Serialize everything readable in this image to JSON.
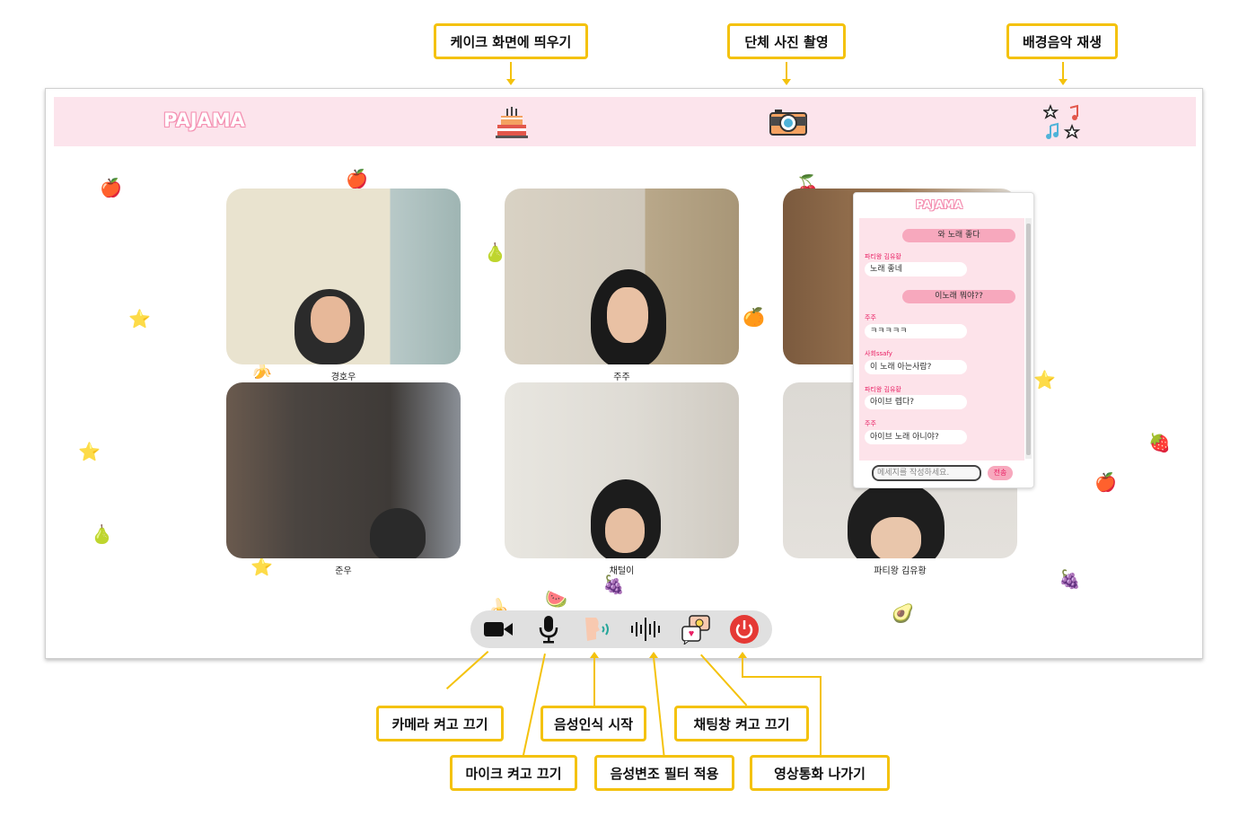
{
  "annotations": {
    "cake": "케이크 화면에 띄우기",
    "photo": "단체 사진 촬영",
    "music": "배경음악 재생",
    "camera": "카메라 켜고 끄기",
    "mic": "마이크 켜고 끄기",
    "speech": "음성인식 시작",
    "voice_filter": "음성변조 필터 적용",
    "chat": "채팅창 켜고 끄기",
    "leave": "영상통화 나가기"
  },
  "app": {
    "logo": "PAJAMA",
    "participants": [
      {
        "name": "경호우"
      },
      {
        "name": "주주"
      },
      {
        "name": ""
      },
      {
        "name": "준우"
      },
      {
        "name": "채털이"
      },
      {
        "name": "파티왕 김유황"
      }
    ],
    "chat": {
      "logo": "PAJAMA",
      "messages": [
        {
          "type": "mine",
          "text": "와 노래 좋다"
        },
        {
          "type": "other",
          "sender": "파티왕 김유황",
          "text": "노래 좋네"
        },
        {
          "type": "mine",
          "text": "이노래 뭐야??"
        },
        {
          "type": "other",
          "sender": "주주",
          "text": "ㅋㅋㅋㅋㅋ"
        },
        {
          "type": "other",
          "sender": "사회ssafy",
          "text": "이 노래 아는사람?"
        },
        {
          "type": "other",
          "sender": "파티왕 김유황",
          "text": "아이브 렙다?"
        },
        {
          "type": "other",
          "sender": "주주",
          "text": "아이브 노래 아니야?"
        }
      ],
      "input_placeholder": "메세지를 작성하세요.",
      "send_label": "전송"
    }
  },
  "colors": {
    "accent": "#f4c20d",
    "topbar": "#fce4ec",
    "pink": "#f7a8bd",
    "leave": "#e53935"
  },
  "icons": {
    "cake": "cake-icon",
    "photo": "camera-photo-icon",
    "music": "music-notes-icon",
    "camera": "video-camera-icon",
    "mic": "microphone-icon",
    "speech": "speech-recognition-icon",
    "voice_filter": "sound-wave-icon",
    "chat": "chat-bubbles-icon",
    "leave": "power-icon"
  }
}
